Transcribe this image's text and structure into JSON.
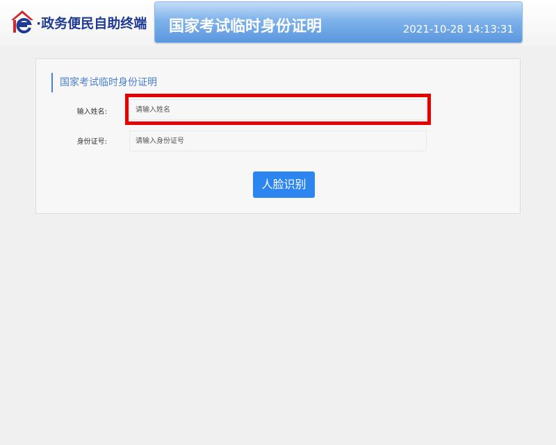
{
  "header": {
    "logo_text": "·政务便民自助终端",
    "banner_title": "国家考试临时身份证明",
    "datetime": "2021-10-28 14:13:31"
  },
  "form": {
    "section_title": "国家考试临时身份证明",
    "name_label": "输入姓名:",
    "name_placeholder": "请输入姓名",
    "id_label": "身份证号:",
    "id_placeholder": "请输入身份证号",
    "submit_label": "人脸识别"
  },
  "colors": {
    "accent": "#2d86f0",
    "highlight": "#e60000",
    "brand": "#1f3a93",
    "logo_red": "#d9232d"
  }
}
